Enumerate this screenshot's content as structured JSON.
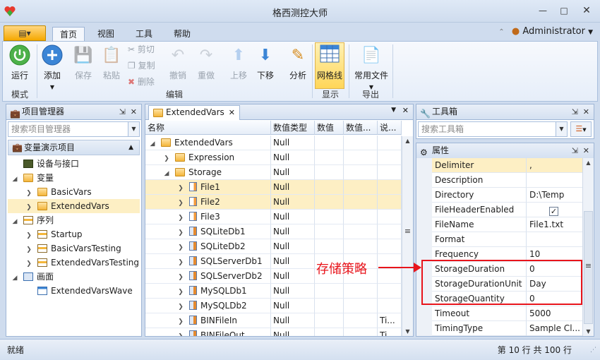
{
  "window": {
    "title": "格西测控大师"
  },
  "ribbon_tabs": [
    "首页",
    "视图",
    "工具",
    "帮助"
  ],
  "user": "Administrator",
  "ribbon": {
    "mode": {
      "run": "运行",
      "group": "模式"
    },
    "edit": {
      "add": "添加",
      "save": "保存",
      "paste": "粘贴",
      "cut": "剪切",
      "copy": "复制",
      "delete": "删除",
      "undo": "撤销",
      "redo": "重做",
      "up": "上移",
      "down": "下移",
      "analyze": "分析",
      "group": "编辑"
    },
    "display": {
      "grid": "网格线",
      "group": "显示"
    },
    "export": {
      "common_files": "常用文件",
      "group": "导出"
    }
  },
  "project_manager": {
    "title": "项目管理器",
    "search_placeholder": "搜索项目管理器",
    "root": "变量演示项目",
    "tree": [
      {
        "label": "设备与接口",
        "indent": 0,
        "icon": "device",
        "arrow": ""
      },
      {
        "label": "变量",
        "indent": 0,
        "icon": "fold",
        "arrow": "v"
      },
      {
        "label": "BasicVars",
        "indent": 1,
        "icon": "fold",
        "arrow": ">"
      },
      {
        "label": "ExtendedVars",
        "indent": 1,
        "icon": "fold",
        "arrow": ">",
        "selected": true
      },
      {
        "label": "序列",
        "indent": 0,
        "icon": "seq",
        "arrow": "v"
      },
      {
        "label": "Startup",
        "indent": 1,
        "icon": "seq",
        "arrow": ">"
      },
      {
        "label": "BasicVarsTesting",
        "indent": 1,
        "icon": "seq",
        "arrow": ">"
      },
      {
        "label": "ExtendedVarsTesting",
        "indent": 1,
        "icon": "seq",
        "arrow": ">"
      },
      {
        "label": "画面",
        "indent": 0,
        "icon": "screen",
        "arrow": "v"
      },
      {
        "label": "ExtendedVarsWave",
        "indent": 1,
        "icon": "wave",
        "arrow": ""
      }
    ]
  },
  "document": {
    "tab": "ExtendedVars",
    "columns": [
      "名称",
      "数值类型",
      "数值",
      "数值...",
      "说..."
    ],
    "rows": [
      {
        "name": "ExtendedVars",
        "type": "Null",
        "value": "",
        "value2": "",
        "note": "",
        "indent": 0,
        "icon": "fold",
        "arrow": "v"
      },
      {
        "name": "Expression",
        "type": "Null",
        "value": "",
        "value2": "",
        "note": "",
        "indent": 1,
        "icon": "fold",
        "arrow": ">"
      },
      {
        "name": "Storage",
        "type": "Null",
        "value": "",
        "value2": "",
        "note": "",
        "indent": 1,
        "icon": "fold",
        "arrow": "v"
      },
      {
        "name": "File1",
        "type": "Null",
        "value": "",
        "value2": "",
        "note": "",
        "indent": 2,
        "icon": "file",
        "arrow": ">",
        "selected": true
      },
      {
        "name": "File2",
        "type": "Null",
        "value": "",
        "value2": "",
        "note": "",
        "indent": 2,
        "icon": "file",
        "arrow": ">",
        "selected": true
      },
      {
        "name": "File3",
        "type": "Null",
        "value": "",
        "value2": "",
        "note": "",
        "indent": 2,
        "icon": "file",
        "arrow": ">"
      },
      {
        "name": "SQLiteDb1",
        "type": "Null",
        "value": "",
        "value2": "",
        "note": "",
        "indent": 2,
        "icon": "db",
        "arrow": ">"
      },
      {
        "name": "SQLiteDb2",
        "type": "Null",
        "value": "",
        "value2": "",
        "note": "",
        "indent": 2,
        "icon": "db",
        "arrow": ">"
      },
      {
        "name": "SQLServerDb1",
        "type": "Null",
        "value": "",
        "value2": "",
        "note": "",
        "indent": 2,
        "icon": "db",
        "arrow": ">"
      },
      {
        "name": "SQLServerDb2",
        "type": "Null",
        "value": "",
        "value2": "",
        "note": "",
        "indent": 2,
        "icon": "db",
        "arrow": ">"
      },
      {
        "name": "MySQLDb1",
        "type": "Null",
        "value": "",
        "value2": "",
        "note": "",
        "indent": 2,
        "icon": "db",
        "arrow": ">"
      },
      {
        "name": "MySQLDb2",
        "type": "Null",
        "value": "",
        "value2": "",
        "note": "",
        "indent": 2,
        "icon": "db",
        "arrow": ">"
      },
      {
        "name": "BINFileIn",
        "type": "Null",
        "value": "",
        "value2": "",
        "note": "Ti...",
        "indent": 2,
        "icon": "db",
        "arrow": ">"
      },
      {
        "name": "BINFileOut",
        "type": "Null",
        "value": "",
        "value2": "",
        "note": "Ti...",
        "indent": 2,
        "icon": "db",
        "arrow": ">"
      }
    ]
  },
  "toolbox": {
    "title": "工具箱",
    "search_placeholder": "搜索工具箱"
  },
  "properties": {
    "title": "属性",
    "rows": [
      {
        "name": "Delimiter",
        "value": ",",
        "selected": true
      },
      {
        "name": "Description",
        "value": ""
      },
      {
        "name": "Directory",
        "value": "D:\\Temp"
      },
      {
        "name": "FileHeaderEnabled",
        "value": "",
        "checkbox": true
      },
      {
        "name": "FileName",
        "value": "File1.txt"
      },
      {
        "name": "Format",
        "value": ""
      },
      {
        "name": "Frequency",
        "value": "10"
      },
      {
        "name": "StorageDuration",
        "value": "0"
      },
      {
        "name": "StorageDurationUnit",
        "value": "Day"
      },
      {
        "name": "StorageQuantity",
        "value": "0"
      },
      {
        "name": "Timeout",
        "value": "5000"
      },
      {
        "name": "TimingType",
        "value": "Sample Cl..."
      }
    ]
  },
  "annotation": {
    "label": "存储策略",
    "color": "#e8141b"
  },
  "status": {
    "left": "就绪",
    "right": "第 10 行 共 100 行"
  }
}
